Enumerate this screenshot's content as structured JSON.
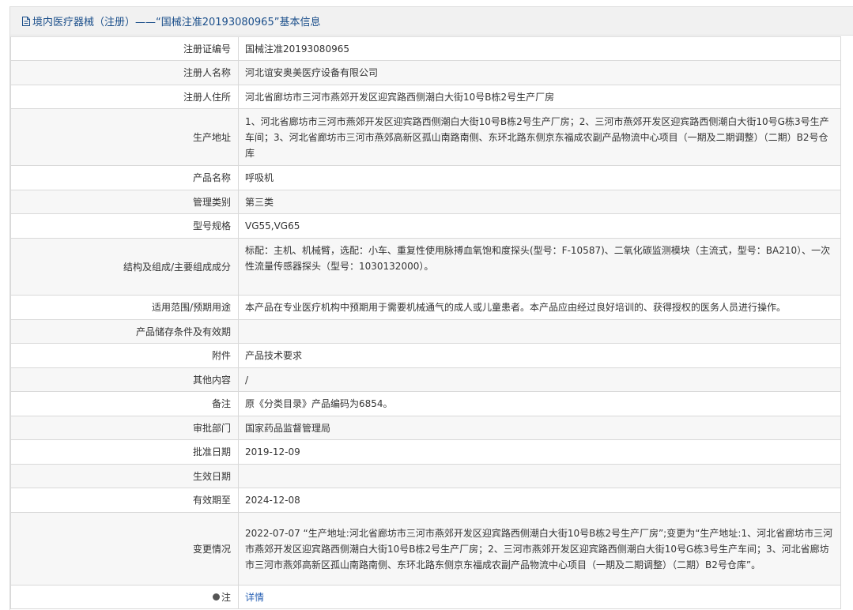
{
  "header": {
    "title": "境内医疗器械（注册）——“国械注准20193080965”基本信息"
  },
  "rows": [
    {
      "label": "注册证编号",
      "value": "国械注准20193080965"
    },
    {
      "label": "注册人名称",
      "value": "河北谊安奥美医疗设备有限公司"
    },
    {
      "label": "注册人住所",
      "value": "河北省廊坊市三河市燕郊开发区迎宾路西侧潮白大街10号B栋2号生产厂房"
    },
    {
      "label": "生产地址",
      "value": "1、河北省廊坊市三河市燕郊开发区迎宾路西侧潮白大街10号B栋2号生产厂房；2、三河市燕郊开发区迎宾路西侧潮白大街10号G栋3号生产车间；3、河北省廊坊市三河市燕郊高新区孤山南路南侧、东环北路东侧京东福成农副产品物流中心项目（一期及二期调整）（二期）B2号仓库"
    },
    {
      "label": "产品名称",
      "value": "呼吸机"
    },
    {
      "label": "管理类别",
      "value": "第三类"
    },
    {
      "label": "型号规格",
      "value": "VG55,VG65"
    },
    {
      "label": "结构及组成/主要组成成分",
      "value": "标配：主机、机械臂，选配：小车、重复性使用脉搏血氧饱和度探头(型号：F-10587)、二氧化碳监测模块（主流式，型号：BA210）、一次性流量传感器探头（型号：1030132000）。"
    },
    {
      "label": "适用范围/预期用途",
      "value": "本产品在专业医疗机构中预期用于需要机械通气的成人或儿童患者。本产品应由经过良好培训的、获得授权的医务人员进行操作。"
    },
    {
      "label": "产品储存条件及有效期",
      "value": ""
    },
    {
      "label": "附件",
      "value": "产品技术要求"
    },
    {
      "label": "其他内容",
      "value": "/"
    },
    {
      "label": "备注",
      "value": "原《分类目录》产品编码为6854。"
    },
    {
      "label": "审批部门",
      "value": "国家药品监督管理局"
    },
    {
      "label": "批准日期",
      "value": "2019-12-09"
    },
    {
      "label": "生效日期",
      "value": ""
    },
    {
      "label": "有效期至",
      "value": "2024-12-08"
    },
    {
      "label": "变更情况",
      "value": "2022-07-07 “生产地址:河北省廊坊市三河市燕郊开发区迎宾路西侧潮白大街10号B栋2号生产厂房”;变更为“生产地址:1、河北省廊坊市三河市燕郊开发区迎宾路西侧潮白大街10号B栋2号生产厂房；2、三河市燕郊开发区迎宾路西侧潮白大街10号G栋3号生产车间；3、河北省廊坊市三河市燕郊高新区孤山南路南侧、东环北路东侧京东福成农副产品物流中心项目（一期及二期调整）（二期）B2号仓库”。"
    },
    {
      "label": "注",
      "value": "详情"
    }
  ]
}
